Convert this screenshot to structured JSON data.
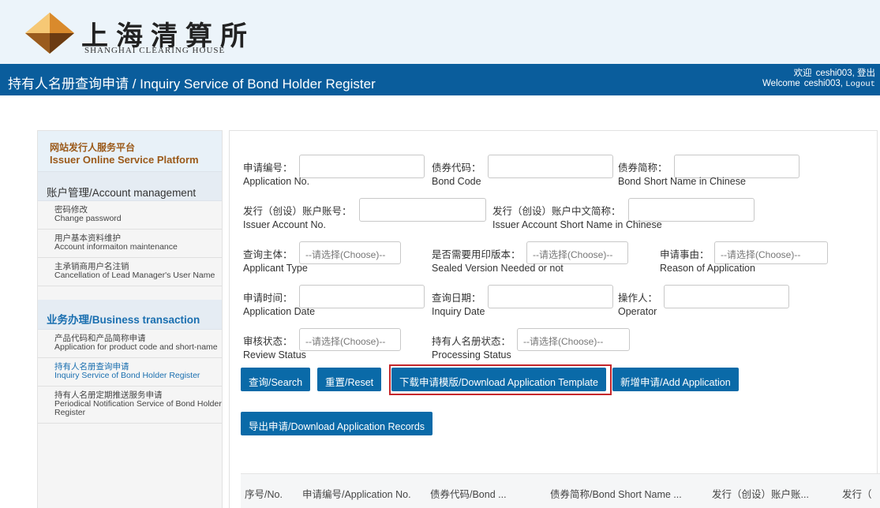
{
  "brand": {
    "name_cn": "上海清算所",
    "name_en": "SHANGHAI  CLEARING  HOUSE",
    "logo_icon": "shch-diamond-logo",
    "logo_colors": [
      "#e8a03a",
      "#7a4a1c"
    ]
  },
  "title_bar": {
    "title": "持有人名册查询申请 / Inquiry Service of Bond Holder Register",
    "welcome_cn": "欢迎",
    "user_cn": "ceshi003,",
    "logout_cn": "登出",
    "welcome_en": "Welcome",
    "user_en": "ceshi003,",
    "logout_en": "Logout",
    "bg_color": "#0a5d9c"
  },
  "sidebar": {
    "platform_cn": "网站发行人服务平台",
    "platform_en": "Issuer Online Service Platform",
    "account_section": "账户管理/Account management",
    "account_items": [
      {
        "cn": "密码修改",
        "en": "Change password"
      },
      {
        "cn": "用户基本资料维护",
        "en": "Account informaiton maintenance"
      },
      {
        "cn": "主承销商用户名注销",
        "en": "Cancellation of Lead Manager's User Name"
      }
    ],
    "business_section": "业务办理/Business transaction",
    "business_items": [
      {
        "cn": "产品代码和产品简称申请",
        "en": "Application for product code and short-name"
      },
      {
        "cn": "持有人名册查询申请",
        "en": "Inquiry Service of Bond Holder Register"
      },
      {
        "cn": "持有人名册定期推送服务申请",
        "en": "Periodical Notification Service of Bond Holder Register"
      }
    ],
    "active_item_color": "#1a6fb0"
  },
  "form": {
    "application_no": {
      "label": "申请编号：",
      "en": "Application No.",
      "value": ""
    },
    "bond_code": {
      "label": "债券代码：",
      "en": "Bond Code",
      "value": ""
    },
    "bond_short_name": {
      "label": "债券简称：",
      "en": "Bond Short Name in Chinese",
      "value": ""
    },
    "issuer_account_no": {
      "label": "发行（创设）账户账号：",
      "en": "Issuer Account No.",
      "value": ""
    },
    "issuer_account_short": {
      "label": "发行（创设）账户中文简称：",
      "en": "Issuer Account Short Name in Chinese",
      "value": ""
    },
    "applicant_type": {
      "label": "查询主体：",
      "en": "Applicant Type",
      "value": "--请选择(Choose)--"
    },
    "sealed_version": {
      "label": "是否需要用印版本：",
      "en": "Sealed Version Needed or not",
      "value": "--请选择(Choose)--"
    },
    "reason": {
      "label": "申请事由：",
      "en": "Reason of Application",
      "value": "--请选择(Choose)--"
    },
    "application_date": {
      "label": "申请时间：",
      "en": "Application Date",
      "value": ""
    },
    "inquiry_date": {
      "label": "查询日期：",
      "en": "Inquiry Date",
      "value": ""
    },
    "operator": {
      "label": "操作人：",
      "en": "Operator",
      "value": ""
    },
    "review_status": {
      "label": "审核状态：",
      "en": "Review Status",
      "value": "--请选择(Choose)--"
    },
    "processing_status": {
      "label": "持有人名册状态：",
      "en": "Processing Status",
      "value": "--请选择(Choose)--"
    }
  },
  "buttons": {
    "search": "查询/Search",
    "reset": "重置/Reset",
    "download_template": "下载申请模版/Download Application Template",
    "add_application": "新增申请/Add Application",
    "export": "导出申请/Download Application Records",
    "button_color": "#0a6aa8",
    "highlight_color": "#c6272b"
  },
  "table": {
    "headers": [
      "序号/No.",
      "申请编号/Application No.",
      "债券代码/Bond ...",
      "债券简称/Bond Short Name ...",
      "发行（创设）账户账...",
      "发行（"
    ]
  }
}
